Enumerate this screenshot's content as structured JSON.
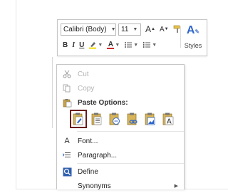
{
  "toolbar": {
    "font_name": "Calibri (Body)",
    "font_size": "11",
    "grow_font": "A",
    "shrink_font": "A",
    "bold": "B",
    "italic": "I",
    "underline": "U",
    "font_color_letter": "A",
    "styles_label": "Styles",
    "styles_icon_letter": "A"
  },
  "menu": {
    "cut": "Cut",
    "copy": "Copy",
    "paste_options": "Paste Options:",
    "font": "Font...",
    "paragraph": "Paragraph...",
    "define": "Define",
    "synonyms": "Synonyms",
    "font_icon_letter": "A"
  },
  "colors": {
    "accent_blue": "#3066c9",
    "selection_border": "#6b1b1b",
    "highlight_yellow": "#f2e23b",
    "font_red": "#d12b2b"
  }
}
